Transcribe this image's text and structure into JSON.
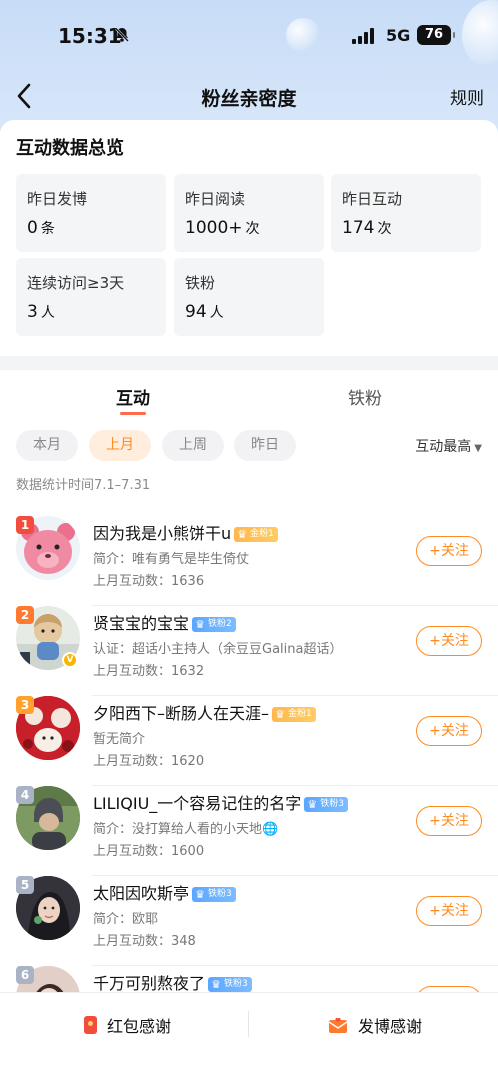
{
  "status_bar": {
    "time": "15:31",
    "network": "5G",
    "battery": "76"
  },
  "nav": {
    "title": "粉丝亲密度",
    "rules_label": "规则"
  },
  "overview": {
    "title": "互动数据总览",
    "stats": [
      {
        "label": "昨日发博",
        "value": "0",
        "unit": "条"
      },
      {
        "label": "昨日阅读",
        "value": "1000+",
        "unit": "次"
      },
      {
        "label": "昨日互动",
        "value": "174",
        "unit": "次"
      },
      {
        "label": "连续访问≥3天",
        "value": "3",
        "unit": "人"
      },
      {
        "label": "铁粉",
        "value": "94",
        "unit": "人"
      }
    ]
  },
  "tabs": [
    {
      "label": "互动",
      "active": true
    },
    {
      "label": "铁粉",
      "active": false
    }
  ],
  "filters": {
    "chips": [
      {
        "label": "本月",
        "active": false
      },
      {
        "label": "上月",
        "active": true
      },
      {
        "label": "上周",
        "active": false
      },
      {
        "label": "昨日",
        "active": false
      }
    ],
    "sort_label": "互动最高"
  },
  "period_text": "数据统计时间7.1–7.31",
  "follow_label": "+关注",
  "fans": [
    {
      "rank": "1",
      "name": "因为我是小熊饼干u",
      "badge": "金粉1",
      "badge_type": "gold",
      "bio": "简介：唯有勇气是毕生倚仗",
      "count": "上月互动数：1636"
    },
    {
      "rank": "2",
      "name": "贤宝宝的宝宝",
      "badge": "铁粉2",
      "badge_type": "blue",
      "bio": "认证：超话小主持人（余豆豆Galina超话）",
      "count": "上月互动数：1632"
    },
    {
      "rank": "3",
      "name": "夕阳西下–断肠人在天涯–",
      "badge": "金粉1",
      "badge_type": "gold",
      "bio": "暂无简介",
      "count": "上月互动数：1620"
    },
    {
      "rank": "4",
      "name": "LILIQIU_一个容易记住的名字",
      "badge": "铁粉3",
      "badge_type": "blue",
      "bio": "简介：没打算给人看的小天地🌐",
      "count": "上月互动数：1600"
    },
    {
      "rank": "5",
      "name": "太阳因吹斯亭",
      "badge": "铁粉3",
      "badge_type": "blue",
      "bio": "简介：欧耶",
      "count": "上月互动数：348"
    },
    {
      "rank": "6",
      "name": "千万可别熬夜了",
      "badge": "铁粉3",
      "badge_type": "blue",
      "bio": "",
      "count": ""
    }
  ],
  "bottom": {
    "red_packet_label": "红包感谢",
    "post_label": "发博感谢"
  },
  "colors": {
    "accent": "#ff8a1f",
    "tab_underline": "#ff6b4a",
    "rank_top": [
      "#f24c3d",
      "#ff7a2f",
      "#ffa22d"
    ],
    "rank_other": "#aab3c6"
  }
}
